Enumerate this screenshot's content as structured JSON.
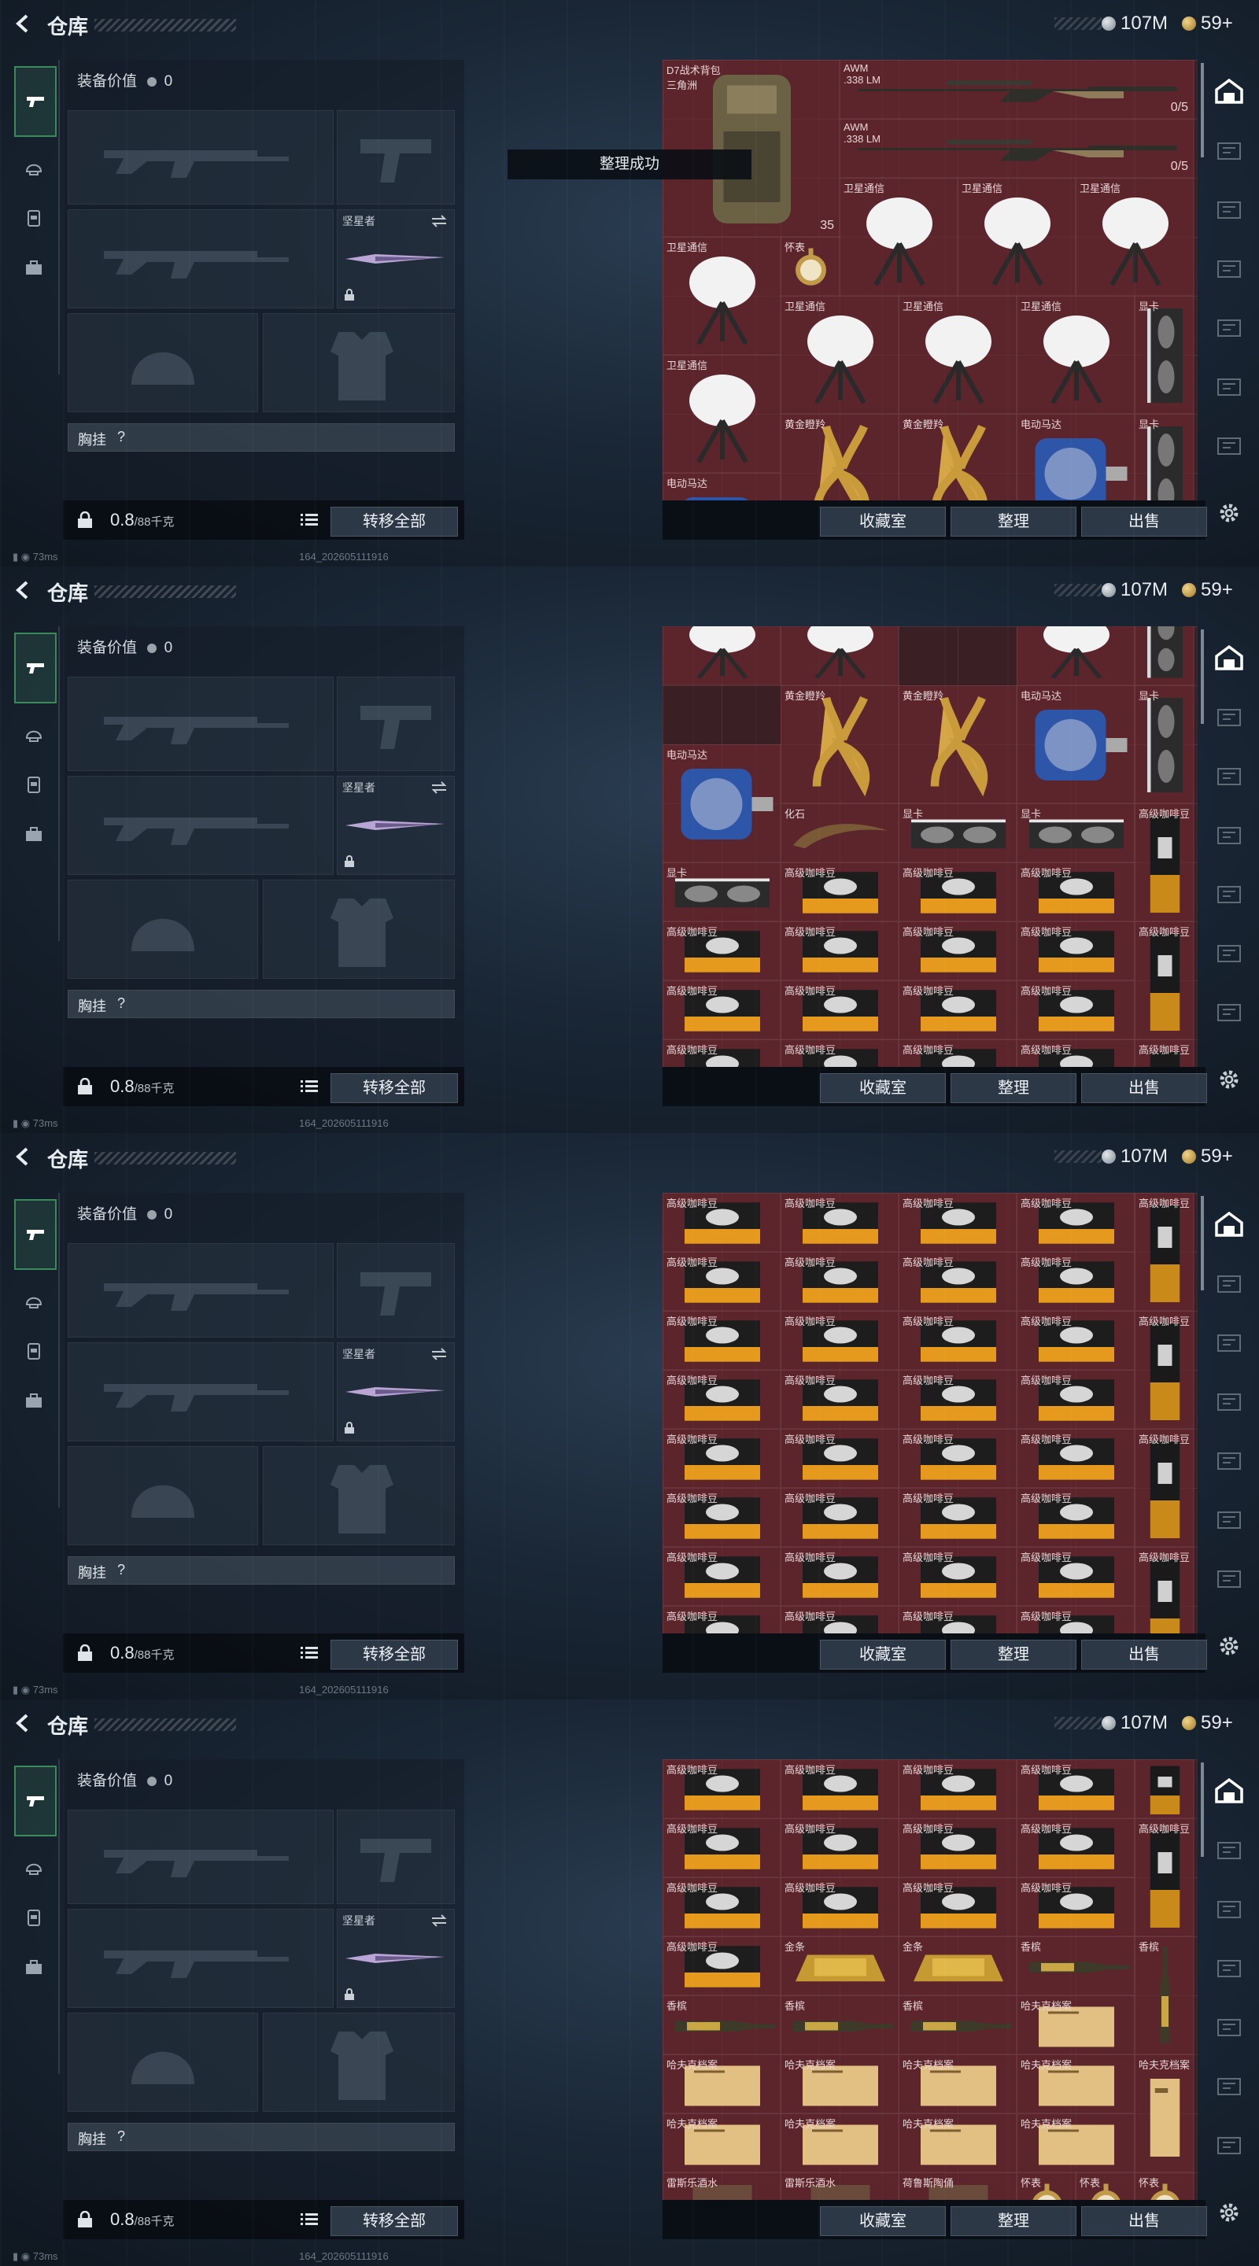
{
  "header": {
    "title": "仓库",
    "money": "107M",
    "tokens": "59+"
  },
  "equipment": {
    "value_label": "装备价值",
    "value": "0",
    "melee_label": "坚星者",
    "chest_label": "胸挂",
    "chest_hint": "?",
    "weight": "0.8",
    "weight_max": "/88千克",
    "transfer_label": "转移全部"
  },
  "stash_buttons": {
    "collection": "收藏室",
    "sort": "整理",
    "sell": "出售"
  },
  "toast": "整理成功",
  "status": {
    "ping": "73ms",
    "version": "164_202605111916"
  },
  "frames": [
    {
      "items": [
        {
          "col": 0,
          "row": 0,
          "w": 1.5,
          "h": 1.5,
          "name": "D7战术背包\n三角洲",
          "kind": "backpack",
          "extra": "35"
        },
        {
          "col": 1.5,
          "row": 0,
          "w": 3,
          "h": 0.5,
          "name": "AWM\n.338 LM",
          "kind": "rifle",
          "extra": "0/5"
        },
        {
          "col": 1.5,
          "row": 0.5,
          "w": 3,
          "h": 0.5,
          "name": "AWM\n.338 LM",
          "kind": "rifle",
          "extra": "0/5"
        },
        {
          "col": 1.5,
          "row": 1,
          "w": 1,
          "h": 1,
          "name": "卫星通信",
          "kind": "dish"
        },
        {
          "col": 2.5,
          "row": 1,
          "w": 1,
          "h": 1,
          "name": "卫星通信",
          "kind": "dish"
        },
        {
          "col": 3.5,
          "row": 1,
          "w": 1,
          "h": 1,
          "name": "卫星通信",
          "kind": "dish"
        },
        {
          "col": 0,
          "row": 1.5,
          "w": 1,
          "h": 1,
          "name": "卫星通信",
          "kind": "dish"
        },
        {
          "col": 1,
          "row": 1.5,
          "w": 0.5,
          "h": 0.5,
          "name": "怀表",
          "kind": "watch"
        },
        {
          "col": 1,
          "row": 2,
          "w": 1,
          "h": 1,
          "name": "卫星通信",
          "kind": "dish"
        },
        {
          "col": 2,
          "row": 2,
          "w": 1,
          "h": 1,
          "name": "卫星通信",
          "kind": "dish"
        },
        {
          "col": 3,
          "row": 2,
          "w": 1,
          "h": 1,
          "name": "卫星通信",
          "kind": "dish"
        },
        {
          "col": 4,
          "row": 2,
          "w": 0.5,
          "h": 1,
          "name": "显卡",
          "kind": "gpu"
        },
        {
          "col": 0,
          "row": 2.5,
          "w": 1,
          "h": 1,
          "name": "卫星通信",
          "kind": "dish"
        },
        {
          "col": 1,
          "row": 3,
          "w": 1,
          "h": 1,
          "name": "黄金瞪羚",
          "kind": "gazelle"
        },
        {
          "col": 2,
          "row": 3,
          "w": 1,
          "h": 1,
          "name": "黄金瞪羚",
          "kind": "gazelle"
        },
        {
          "col": 3,
          "row": 3,
          "w": 1,
          "h": 1,
          "name": "电动马达",
          "kind": "motor"
        },
        {
          "col": 4,
          "row": 3,
          "w": 0.5,
          "h": 1,
          "name": "显卡",
          "kind": "gpu"
        },
        {
          "col": 0,
          "row": 3.5,
          "w": 1,
          "h": 1,
          "name": "电动马达",
          "kind": "motor"
        }
      ]
    },
    {
      "items": [
        {
          "col": 0,
          "row": -0.2,
          "w": 1,
          "h": 0.7,
          "name": "卫星通信",
          "kind": "dish"
        },
        {
          "col": 1,
          "row": -0.2,
          "w": 1,
          "h": 0.7,
          "name": "",
          "kind": "dish"
        },
        {
          "col": 3,
          "row": -0.2,
          "w": 1,
          "h": 0.7,
          "name": "",
          "kind": "dish"
        },
        {
          "col": 4,
          "row": -0.2,
          "w": 0.5,
          "h": 0.7,
          "name": "",
          "kind": "gpu"
        },
        {
          "col": 1,
          "row": 0.5,
          "w": 1,
          "h": 1,
          "name": "黄金瞪羚",
          "kind": "gazelle"
        },
        {
          "col": 2,
          "row": 0.5,
          "w": 1,
          "h": 1,
          "name": "黄金瞪羚",
          "kind": "gazelle"
        },
        {
          "col": 3,
          "row": 0.5,
          "w": 1,
          "h": 1,
          "name": "电动马达",
          "kind": "motor"
        },
        {
          "col": 4,
          "row": 0.5,
          "w": 0.5,
          "h": 1,
          "name": "显卡",
          "kind": "gpu"
        },
        {
          "col": 0,
          "row": 1,
          "w": 1,
          "h": 1,
          "name": "电动马达",
          "kind": "motor"
        },
        {
          "col": 1,
          "row": 1.5,
          "w": 1,
          "h": 0.5,
          "name": "化石",
          "kind": "fossil"
        },
        {
          "col": 2,
          "row": 1.5,
          "w": 1,
          "h": 0.5,
          "name": "显卡",
          "kind": "gpuh"
        },
        {
          "col": 3,
          "row": 1.5,
          "w": 1,
          "h": 0.5,
          "name": "显卡",
          "kind": "gpuh"
        },
        {
          "col": 4,
          "row": 1.5,
          "w": 0.5,
          "h": 1,
          "name": "高级咖啡豆",
          "kind": "bag"
        },
        {
          "col": 0,
          "row": 2,
          "w": 1,
          "h": 0.5,
          "name": "显卡",
          "kind": "gpuh"
        },
        {
          "col": 1,
          "row": 2,
          "w": 1,
          "h": 0.5,
          "name": "高级咖啡豆",
          "kind": "coffee"
        },
        {
          "col": 2,
          "row": 2,
          "w": 1,
          "h": 0.5,
          "name": "高级咖啡豆",
          "kind": "coffee"
        },
        {
          "col": 3,
          "row": 2,
          "w": 1,
          "h": 0.5,
          "name": "高级咖啡豆",
          "kind": "coffee"
        },
        {
          "col": 0,
          "row": 2.5,
          "w": 1,
          "h": 0.5,
          "name": "高级咖啡豆",
          "kind": "coffee"
        },
        {
          "col": 1,
          "row": 2.5,
          "w": 1,
          "h": 0.5,
          "name": "高级咖啡豆",
          "kind": "coffee"
        },
        {
          "col": 2,
          "row": 2.5,
          "w": 1,
          "h": 0.5,
          "name": "高级咖啡豆",
          "kind": "coffee"
        },
        {
          "col": 3,
          "row": 2.5,
          "w": 1,
          "h": 0.5,
          "name": "高级咖啡豆",
          "kind": "coffee"
        },
        {
          "col": 4,
          "row": 2.5,
          "w": 0.5,
          "h": 1,
          "name": "高级咖啡豆",
          "kind": "bag"
        },
        {
          "col": 0,
          "row": 3,
          "w": 1,
          "h": 0.5,
          "name": "高级咖啡豆",
          "kind": "coffee"
        },
        {
          "col": 1,
          "row": 3,
          "w": 1,
          "h": 0.5,
          "name": "高级咖啡豆",
          "kind": "coffee"
        },
        {
          "col": 2,
          "row": 3,
          "w": 1,
          "h": 0.5,
          "name": "高级咖啡豆",
          "kind": "coffee"
        },
        {
          "col": 3,
          "row": 3,
          "w": 1,
          "h": 0.5,
          "name": "高级咖啡豆",
          "kind": "coffee"
        },
        {
          "col": 0,
          "row": 3.5,
          "w": 1,
          "h": 0.5,
          "name": "高级咖啡豆",
          "kind": "coffee"
        },
        {
          "col": 1,
          "row": 3.5,
          "w": 1,
          "h": 0.5,
          "name": "高级咖啡豆",
          "kind": "coffee"
        },
        {
          "col": 2,
          "row": 3.5,
          "w": 1,
          "h": 0.5,
          "name": "高级咖啡豆",
          "kind": "coffee"
        },
        {
          "col": 3,
          "row": 3.5,
          "w": 1,
          "h": 0.5,
          "name": "高级咖啡豆",
          "kind": "coffee"
        },
        {
          "col": 4,
          "row": 3.5,
          "w": 0.5,
          "h": 1,
          "name": "高级咖啡豆",
          "kind": "bag"
        }
      ]
    },
    {
      "items": [
        {
          "col": 0,
          "row": 0,
          "w": 1,
          "h": 0.5,
          "name": "高级咖啡豆",
          "kind": "coffee"
        },
        {
          "col": 1,
          "row": 0,
          "w": 1,
          "h": 0.5,
          "name": "高级咖啡豆",
          "kind": "coffee"
        },
        {
          "col": 2,
          "row": 0,
          "w": 1,
          "h": 0.5,
          "name": "高级咖啡豆",
          "kind": "coffee"
        },
        {
          "col": 3,
          "row": 0,
          "w": 1,
          "h": 0.5,
          "name": "高级咖啡豆",
          "kind": "coffee"
        },
        {
          "col": 4,
          "row": 0,
          "w": 0.5,
          "h": 1,
          "name": "高级咖啡豆",
          "kind": "bag"
        },
        {
          "col": 0,
          "row": 0.5,
          "w": 1,
          "h": 0.5,
          "name": "高级咖啡豆",
          "kind": "coffee"
        },
        {
          "col": 1,
          "row": 0.5,
          "w": 1,
          "h": 0.5,
          "name": "高级咖啡豆",
          "kind": "coffee"
        },
        {
          "col": 2,
          "row": 0.5,
          "w": 1,
          "h": 0.5,
          "name": "高级咖啡豆",
          "kind": "coffee"
        },
        {
          "col": 3,
          "row": 0.5,
          "w": 1,
          "h": 0.5,
          "name": "高级咖啡豆",
          "kind": "coffee"
        },
        {
          "col": 0,
          "row": 1,
          "w": 1,
          "h": 0.5,
          "name": "高级咖啡豆",
          "kind": "coffee"
        },
        {
          "col": 1,
          "row": 1,
          "w": 1,
          "h": 0.5,
          "name": "高级咖啡豆",
          "kind": "coffee"
        },
        {
          "col": 2,
          "row": 1,
          "w": 1,
          "h": 0.5,
          "name": "高级咖啡豆",
          "kind": "coffee"
        },
        {
          "col": 3,
          "row": 1,
          "w": 1,
          "h": 0.5,
          "name": "高级咖啡豆",
          "kind": "coffee"
        },
        {
          "col": 4,
          "row": 1,
          "w": 0.5,
          "h": 1,
          "name": "高级咖啡豆",
          "kind": "bag"
        },
        {
          "col": 0,
          "row": 1.5,
          "w": 1,
          "h": 0.5,
          "name": "高级咖啡豆",
          "kind": "coffee"
        },
        {
          "col": 1,
          "row": 1.5,
          "w": 1,
          "h": 0.5,
          "name": "高级咖啡豆",
          "kind": "coffee"
        },
        {
          "col": 2,
          "row": 1.5,
          "w": 1,
          "h": 0.5,
          "name": "高级咖啡豆",
          "kind": "coffee"
        },
        {
          "col": 3,
          "row": 1.5,
          "w": 1,
          "h": 0.5,
          "name": "高级咖啡豆",
          "kind": "coffee"
        },
        {
          "col": 0,
          "row": 2,
          "w": 1,
          "h": 0.5,
          "name": "高级咖啡豆",
          "kind": "coffee"
        },
        {
          "col": 1,
          "row": 2,
          "w": 1,
          "h": 0.5,
          "name": "高级咖啡豆",
          "kind": "coffee"
        },
        {
          "col": 2,
          "row": 2,
          "w": 1,
          "h": 0.5,
          "name": "高级咖啡豆",
          "kind": "coffee"
        },
        {
          "col": 3,
          "row": 2,
          "w": 1,
          "h": 0.5,
          "name": "高级咖啡豆",
          "kind": "coffee"
        },
        {
          "col": 4,
          "row": 2,
          "w": 0.5,
          "h": 1,
          "name": "高级咖啡豆",
          "kind": "bag"
        },
        {
          "col": 0,
          "row": 2.5,
          "w": 1,
          "h": 0.5,
          "name": "高级咖啡豆",
          "kind": "coffee"
        },
        {
          "col": 1,
          "row": 2.5,
          "w": 1,
          "h": 0.5,
          "name": "高级咖啡豆",
          "kind": "coffee"
        },
        {
          "col": 2,
          "row": 2.5,
          "w": 1,
          "h": 0.5,
          "name": "高级咖啡豆",
          "kind": "coffee"
        },
        {
          "col": 3,
          "row": 2.5,
          "w": 1,
          "h": 0.5,
          "name": "高级咖啡豆",
          "kind": "coffee"
        },
        {
          "col": 0,
          "row": 3,
          "w": 1,
          "h": 0.5,
          "name": "高级咖啡豆",
          "kind": "coffee"
        },
        {
          "col": 1,
          "row": 3,
          "w": 1,
          "h": 0.5,
          "name": "高级咖啡豆",
          "kind": "coffee"
        },
        {
          "col": 2,
          "row": 3,
          "w": 1,
          "h": 0.5,
          "name": "高级咖啡豆",
          "kind": "coffee"
        },
        {
          "col": 3,
          "row": 3,
          "w": 1,
          "h": 0.5,
          "name": "高级咖啡豆",
          "kind": "coffee"
        },
        {
          "col": 4,
          "row": 3,
          "w": 0.5,
          "h": 1,
          "name": "高级咖啡豆",
          "kind": "bag"
        },
        {
          "col": 0,
          "row": 3.5,
          "w": 1,
          "h": 0.5,
          "name": "高级咖啡豆",
          "kind": "coffee"
        },
        {
          "col": 1,
          "row": 3.5,
          "w": 1,
          "h": 0.5,
          "name": "高级咖啡豆",
          "kind": "coffee"
        },
        {
          "col": 2,
          "row": 3.5,
          "w": 1,
          "h": 0.5,
          "name": "高级咖啡豆",
          "kind": "coffee"
        },
        {
          "col": 3,
          "row": 3.5,
          "w": 1,
          "h": 0.5,
          "name": "高级咖啡豆",
          "kind": "coffee"
        }
      ]
    },
    {
      "items": [
        {
          "col": 0,
          "row": 0,
          "w": 1,
          "h": 0.5,
          "name": "高级咖啡豆",
          "kind": "coffee"
        },
        {
          "col": 1,
          "row": 0,
          "w": 1,
          "h": 0.5,
          "name": "高级咖啡豆",
          "kind": "coffee"
        },
        {
          "col": 2,
          "row": 0,
          "w": 1,
          "h": 0.5,
          "name": "高级咖啡豆",
          "kind": "coffee"
        },
        {
          "col": 3,
          "row": 0,
          "w": 1,
          "h": 0.5,
          "name": "高级咖啡豆",
          "kind": "coffee"
        },
        {
          "col": 4,
          "row": 0,
          "w": 0.5,
          "h": 0.5,
          "name": "",
          "kind": "bag"
        },
        {
          "col": 0,
          "row": 0.5,
          "w": 1,
          "h": 0.5,
          "name": "高级咖啡豆",
          "kind": "coffee"
        },
        {
          "col": 1,
          "row": 0.5,
          "w": 1,
          "h": 0.5,
          "name": "高级咖啡豆",
          "kind": "coffee"
        },
        {
          "col": 2,
          "row": 0.5,
          "w": 1,
          "h": 0.5,
          "name": "高级咖啡豆",
          "kind": "coffee"
        },
        {
          "col": 3,
          "row": 0.5,
          "w": 1,
          "h": 0.5,
          "name": "高级咖啡豆",
          "kind": "coffee"
        },
        {
          "col": 4,
          "row": 0.5,
          "w": 0.5,
          "h": 1,
          "name": "高级咖啡豆",
          "kind": "bag"
        },
        {
          "col": 0,
          "row": 1,
          "w": 1,
          "h": 0.5,
          "name": "高级咖啡豆",
          "kind": "coffee"
        },
        {
          "col": 1,
          "row": 1,
          "w": 1,
          "h": 0.5,
          "name": "高级咖啡豆",
          "kind": "coffee"
        },
        {
          "col": 2,
          "row": 1,
          "w": 1,
          "h": 0.5,
          "name": "高级咖啡豆",
          "kind": "coffee"
        },
        {
          "col": 3,
          "row": 1,
          "w": 1,
          "h": 0.5,
          "name": "高级咖啡豆",
          "kind": "coffee"
        },
        {
          "col": 0,
          "row": 1.5,
          "w": 1,
          "h": 0.5,
          "name": "高级咖啡豆",
          "kind": "coffee"
        },
        {
          "col": 1,
          "row": 1.5,
          "w": 1,
          "h": 0.5,
          "name": "金条",
          "kind": "gold"
        },
        {
          "col": 2,
          "row": 1.5,
          "w": 1,
          "h": 0.5,
          "name": "金条",
          "kind": "gold"
        },
        {
          "col": 3,
          "row": 1.5,
          "w": 1,
          "h": 0.5,
          "name": "香槟",
          "kind": "bottleh"
        },
        {
          "col": 4,
          "row": 1.5,
          "w": 0.5,
          "h": 1,
          "name": "香槟",
          "kind": "bottle"
        },
        {
          "col": 0,
          "row": 2,
          "w": 1,
          "h": 0.5,
          "name": "香槟",
          "kind": "bottleh"
        },
        {
          "col": 1,
          "row": 2,
          "w": 1,
          "h": 0.5,
          "name": "香槟",
          "kind": "bottleh"
        },
        {
          "col": 2,
          "row": 2,
          "w": 1,
          "h": 0.5,
          "name": "香槟",
          "kind": "bottleh"
        },
        {
          "col": 3,
          "row": 2,
          "w": 1,
          "h": 0.5,
          "name": "哈夫克档案",
          "kind": "files"
        },
        {
          "col": 0,
          "row": 2.5,
          "w": 1,
          "h": 0.5,
          "name": "哈夫克档案",
          "kind": "files"
        },
        {
          "col": 1,
          "row": 2.5,
          "w": 1,
          "h": 0.5,
          "name": "哈夫克档案",
          "kind": "files"
        },
        {
          "col": 2,
          "row": 2.5,
          "w": 1,
          "h": 0.5,
          "name": "哈夫克档案",
          "kind": "files"
        },
        {
          "col": 3,
          "row": 2.5,
          "w": 1,
          "h": 0.5,
          "name": "哈夫克档案",
          "kind": "files"
        },
        {
          "col": 4,
          "row": 2.5,
          "w": 0.5,
          "h": 1,
          "name": "哈夫克档案",
          "kind": "filesv"
        },
        {
          "col": 0,
          "row": 3,
          "w": 1,
          "h": 0.5,
          "name": "哈夫克档案",
          "kind": "files"
        },
        {
          "col": 1,
          "row": 3,
          "w": 1,
          "h": 0.5,
          "name": "哈夫克档案",
          "kind": "files"
        },
        {
          "col": 2,
          "row": 3,
          "w": 1,
          "h": 0.5,
          "name": "哈夫克档案",
          "kind": "files"
        },
        {
          "col": 3,
          "row": 3,
          "w": 1,
          "h": 0.5,
          "name": "哈夫克档案",
          "kind": "files"
        },
        {
          "col": 0,
          "row": 3.5,
          "w": 1,
          "h": 0.5,
          "name": "雷斯乐酒水",
          "kind": "misc"
        },
        {
          "col": 1,
          "row": 3.5,
          "w": 1,
          "h": 0.5,
          "name": "雷斯乐酒水",
          "kind": "misc"
        },
        {
          "col": 2,
          "row": 3.5,
          "w": 1,
          "h": 0.5,
          "name": "荷鲁斯陶俑",
          "kind": "misc"
        },
        {
          "col": 3,
          "row": 3.5,
          "w": 0.5,
          "h": 0.5,
          "name": "怀表",
          "kind": "watch"
        },
        {
          "col": 3.5,
          "row": 3.5,
          "w": 0.5,
          "h": 0.5,
          "name": "怀表",
          "kind": "watch"
        },
        {
          "col": 4,
          "row": 3.5,
          "w": 0.5,
          "h": 0.5,
          "name": "怀表",
          "kind": "watch"
        }
      ]
    }
  ]
}
